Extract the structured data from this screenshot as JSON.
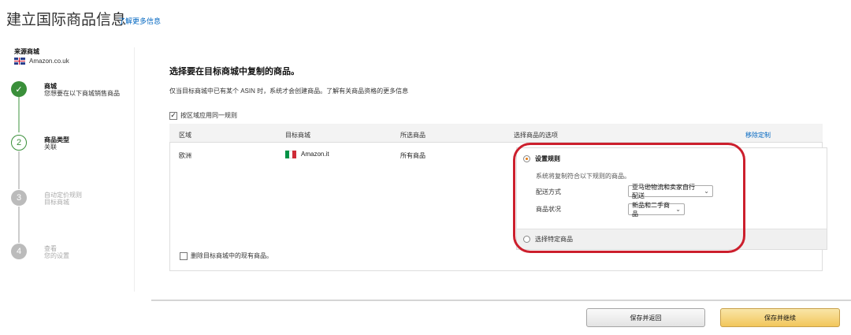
{
  "page": {
    "title": "建立国际商品信息",
    "learn_more": "了解更多信息"
  },
  "source": {
    "label": "来源商城",
    "store": "Amazon.co.uk"
  },
  "steps": [
    {
      "index": "✓",
      "title": "商城",
      "subtitle": "您想要在以下商城销售商品",
      "state": "done"
    },
    {
      "index": "2",
      "title": "商品类型",
      "subtitle": "关联",
      "state": "current"
    },
    {
      "index": "3",
      "title": "自动定价规则",
      "subtitle": "目标商城",
      "state": "future"
    },
    {
      "index": "4",
      "title": "查看",
      "subtitle": "您的设置",
      "state": "future"
    }
  ],
  "main": {
    "heading": "选择要在目标商城中复制的商品。",
    "description": "仅当目标商城中已有某个 ASIN 时，系统才会创建商品。了解有关商品资格的更多信息",
    "apply_same_rule": "按区域应用同一规则",
    "apply_same_rule_checked": true
  },
  "table": {
    "headers": {
      "region": "区域",
      "target_store": "目标商城",
      "selected_products": "所选商品",
      "product_options": "选择商品的选项",
      "remove": "移除定制"
    },
    "row": {
      "region": "欧洲",
      "target_store": "Amazon.it",
      "selected_products": "所有商品"
    },
    "options": {
      "set_rules": "设置规则",
      "set_rules_selected": true,
      "rules_desc": "系统将复制符合以下规则的商品。",
      "fulfillment_label": "配送方式",
      "fulfillment_value": "亚马逊物流和卖家自行配送",
      "condition_label": "商品状况",
      "condition_value": "新品和二手商品",
      "choose_specific": "选择特定商品"
    },
    "exclude_existing": "删除目标商城中的现有商品。"
  },
  "footer": {
    "save_back": "保存并返回",
    "save_continue": "保存并继续"
  },
  "colors": {
    "accent_green": "#3a8f3a",
    "link_blue": "#0066c0",
    "highlight_red": "#cc1f2d",
    "primary_button": "#f2c65b"
  }
}
